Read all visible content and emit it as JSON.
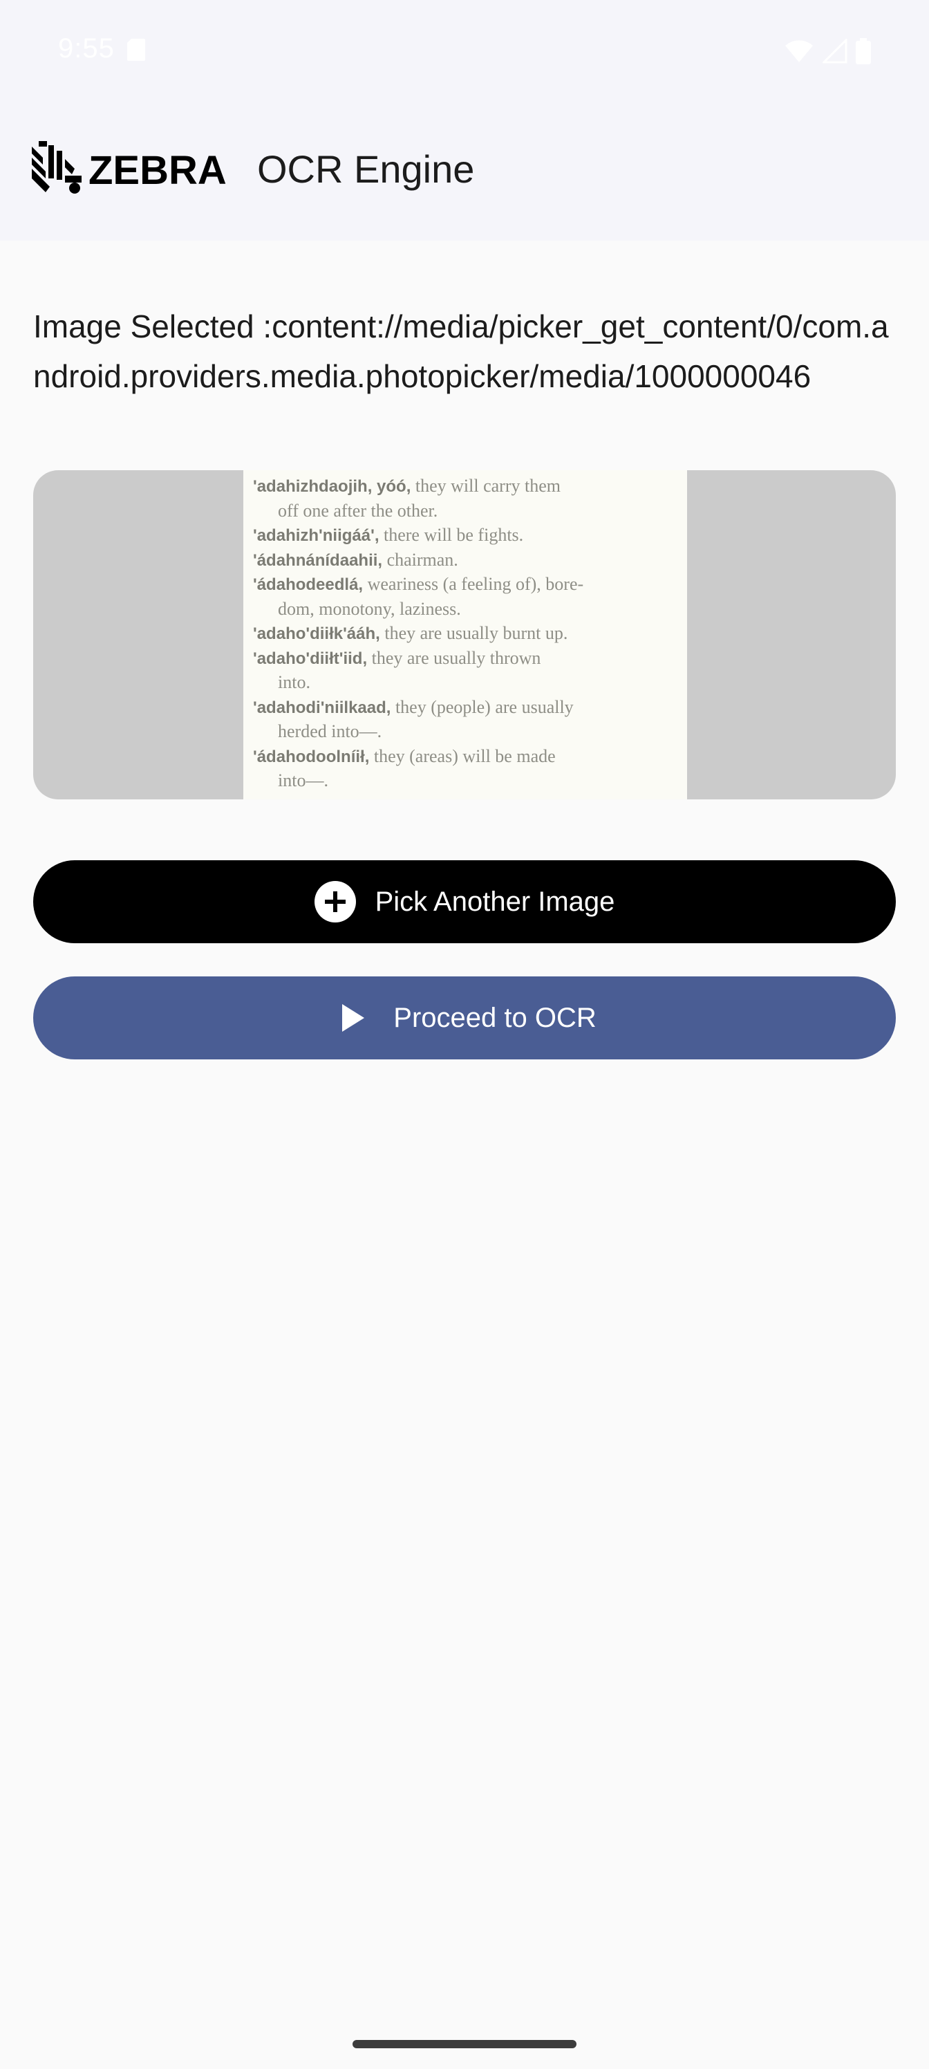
{
  "status_bar": {
    "time": "9:55"
  },
  "app_bar": {
    "brand": "ZEBRA",
    "title": "OCR Engine"
  },
  "selection": {
    "text": "Image Selected :content://media/picker_get_content/0/com.android.providers.media.photopicker/media/1000000046"
  },
  "preview": {
    "lines": [
      {
        "term": "'adahizhdaojih, yóó,",
        "def": " they will carry them"
      },
      {
        "term": "",
        "def": "off one after the other."
      },
      {
        "term": "'adahizh'niigáá',",
        "def": " there will be fights."
      },
      {
        "term": "'ádahnánídaahii,",
        "def": " chairman."
      },
      {
        "term": "'ádahodeedlá,",
        "def": " weariness (a feeling of), bore-"
      },
      {
        "term": "",
        "def": "dom, monotony, laziness."
      },
      {
        "term": "'adaho'diiłk'ááh,",
        "def": " they are usually burnt up."
      },
      {
        "term": "'adaho'diiłt'iid,",
        "def": " they are usually thrown"
      },
      {
        "term": "",
        "def": "into."
      },
      {
        "term": "'adahodi'niilkaad,",
        "def": " they (people) are usually"
      },
      {
        "term": "",
        "def": "herded into—."
      },
      {
        "term": "'ádahodoolníił,",
        "def": " they (areas) will be made"
      },
      {
        "term": "",
        "def": "into—."
      }
    ]
  },
  "buttons": {
    "pick": "Pick Another Image",
    "proceed": "Proceed to OCR"
  },
  "colors": {
    "pick_bg": "#000000",
    "proceed_bg": "#4a5d94",
    "app_bar_bg": "#f5f5fa",
    "page_bg": "#fafafa"
  },
  "icons": {
    "pick": "add-circle-icon",
    "proceed": "play-icon"
  }
}
